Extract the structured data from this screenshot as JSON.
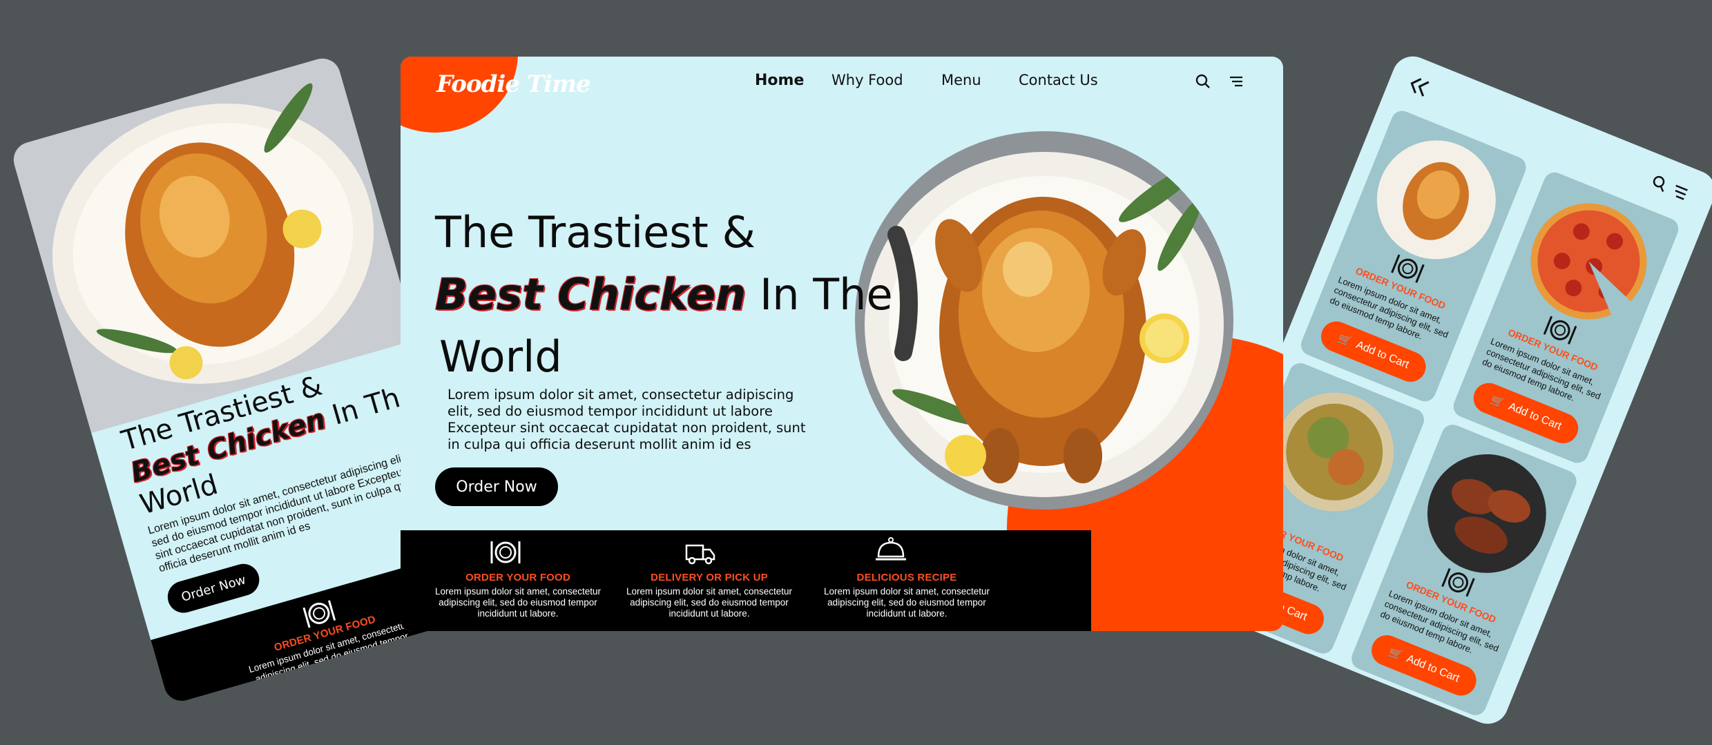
{
  "brand": {
    "logo": "Foodie Time"
  },
  "nav": {
    "home": "Home",
    "why": "Why Food",
    "menu": "Menu",
    "contact": "Contact Us"
  },
  "hero": {
    "line1": "The Trastiest &",
    "accent": "Best Chicken",
    "line2_rest": "In The",
    "line3": "World",
    "body": "Lorem ipsum dolor sit amet, consectetur adipiscing elit, sed do eiusmod tempor incididunt ut labore Excepteur sint occaecat cupidatat non proident, sunt in culpa qui officia deserunt mollit anim id es",
    "cta": "Order Now"
  },
  "features": [
    {
      "title": "ORDER YOUR FOOD",
      "text": "Lorem ipsum dolor sit amet, consectetur adipiscing elit, sed do eiusmod tempor incididunt ut labore."
    },
    {
      "title": "DELIVERY OR PICK UP",
      "text": "Lorem ipsum dolor sit amet, consectetur adipiscing elit, sed do eiusmod tempor incididunt ut labore."
    },
    {
      "title": "DELICIOUS RECIPE",
      "text": "Lorem ipsum dolor sit amet, consectetur adipiscing elit, sed do eiusmod tempor incididunt ut labore."
    }
  ],
  "mobile": {
    "card_title": "ORDER YOUR FOOD",
    "card_text": "Lorem ipsum dolor sit amet, consectetur adipiscing elit, sed do eiusmod temp  labore.",
    "cart": "Add to Cart"
  },
  "colors": {
    "accent": "#ff4500",
    "background": "#d1f2f6",
    "page": "#4f5457"
  }
}
